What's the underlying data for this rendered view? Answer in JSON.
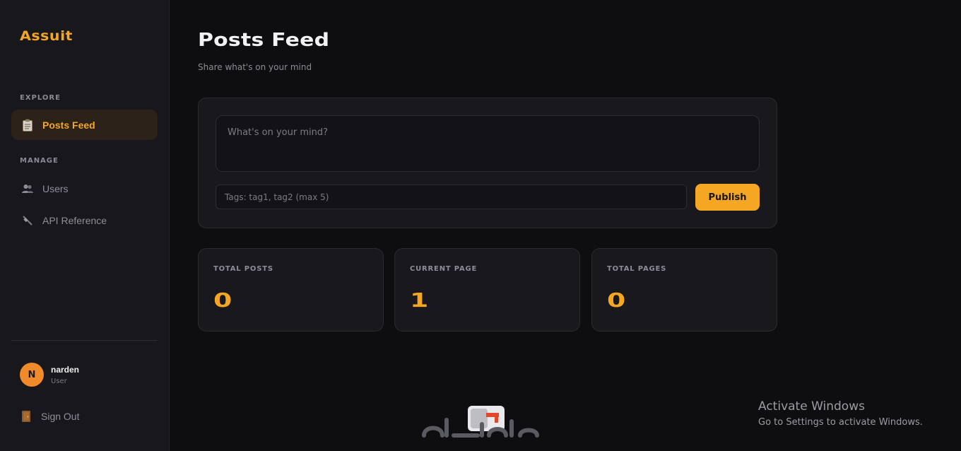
{
  "sidebar": {
    "logo": "Assuit",
    "sections": [
      {
        "label": "EXPLORE"
      },
      {
        "label": "MANAGE"
      }
    ],
    "items": [
      {
        "label": "Posts Feed",
        "icon": "clipboard-icon",
        "active": true
      },
      {
        "label": "Users",
        "icon": "users-icon",
        "active": false
      },
      {
        "label": "API Reference",
        "icon": "plug-icon",
        "active": false
      }
    ],
    "user": {
      "initial": "N",
      "name": "narden",
      "role": "User"
    },
    "signout_label": "Sign Out",
    "signout_icon": "door-icon"
  },
  "header": {
    "title": "Posts Feed",
    "subtitle": "Share what's on your mind"
  },
  "composer": {
    "post_placeholder": "What's on your mind?",
    "post_value": "",
    "tags_placeholder": "Tags: tag1, tag2 (max 5)",
    "tags_value": "",
    "publish_label": "Publish"
  },
  "stats": [
    {
      "label": "TOTAL POSTS",
      "value": "0"
    },
    {
      "label": "CURRENT PAGE",
      "value": "1"
    },
    {
      "label": "TOTAL PAGES",
      "value": "0"
    }
  ],
  "system_overlay": {
    "title": "Activate Windows",
    "subtitle": "Go to Settings to activate Windows."
  },
  "colors": {
    "accent": "#f5a623",
    "background": "#0e0e11",
    "sidebar": "#17171c",
    "card": "#18181d",
    "active_nav_bg": "#2c2219"
  }
}
